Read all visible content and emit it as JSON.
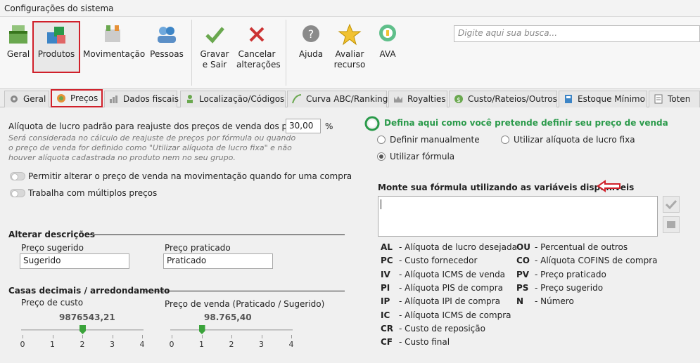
{
  "window": {
    "title": "Configurações do sistema"
  },
  "toolbar": {
    "geral": "Geral",
    "produtos": "Produtos",
    "movimentacao": "Movimentação",
    "pessoas": "Pessoas",
    "gravar_line1": "Gravar",
    "gravar_line2": "e Sair",
    "cancelar_line1": "Cancelar",
    "cancelar_line2": "alterações",
    "ajuda": "Ajuda",
    "avaliar_line1": "Avaliar",
    "avaliar_line2": "recurso",
    "ava": "AVA"
  },
  "search": {
    "placeholder": "Digite aqui sua busca..."
  },
  "tabs": [
    "Geral",
    "Preços",
    "Dados fiscais",
    "Localização/Códigos",
    "Curva ABC/Ranking",
    "Royalties",
    "Custo/Rateios/Outros",
    "Estoque Mínimo",
    "Toten"
  ],
  "left": {
    "profit_label": "Alíquota de lucro padrão para reajuste dos preços de venda dos produtos",
    "profit_value": "30,00",
    "profit_unit": "%",
    "note1": "Será considerada no cálculo de reajuste de preços por fórmula ou quando",
    "note2": "o preço de venda for definido como \"Utilizar alíquota de lucro fixa\" e não",
    "note3": "houver alíquota cadastrada no produto nem no seu grupo.",
    "toggle1": "Permitir alterar o preço de venda na movimentação quando for uma compra",
    "toggle2": "Trabalha com múltiplos preços",
    "alter_title": "Alterar descrições",
    "sugerido_label": "Preço sugerido",
    "sugerido_value": "Sugerido",
    "praticado_label": "Preço praticado",
    "praticado_value": "Praticado",
    "casas_title": "Casas decimais / arredondamento",
    "custo_label": "Preço de custo",
    "custo_value": "9876543,21",
    "custo_level": 2,
    "venda_label": "Preço de venda (Praticado / Sugerido)",
    "venda_value": "98.765,40",
    "venda_level": 1,
    "ticks": [
      "0",
      "1",
      "2",
      "3",
      "4"
    ]
  },
  "right": {
    "define_title": "Defina aqui como você pretende definir seu preço de venda",
    "opt_manual": "Definir manualmente",
    "opt_fixa": "Utilizar alíquota de lucro fixa",
    "opt_formula": "Utilizar fórmula",
    "formula_title": "Monte sua fórmula utilizando as variáveis disponíveis",
    "vars_left": [
      {
        "code": "AL",
        "desc": "- Alíquota de lucro desejada"
      },
      {
        "code": "PC",
        "desc": "- Custo fornecedor"
      },
      {
        "code": "IV",
        "desc": "- Alíquota ICMS de venda"
      },
      {
        "code": "PI",
        "desc": "- Alíquota PIS de compra"
      },
      {
        "code": "IP",
        "desc": "- Alíquota IPI de compra"
      },
      {
        "code": "IC",
        "desc": "- Alíquota ICMS de compra"
      },
      {
        "code": "CR",
        "desc": "- Custo de reposição"
      },
      {
        "code": "CF",
        "desc": "- Custo final"
      }
    ],
    "vars_right": [
      {
        "code": "OU",
        "desc": "- Percentual de outros"
      },
      {
        "code": "CO",
        "desc": "- Alíquota COFINS de compra"
      },
      {
        "code": "PV",
        "desc": "- Preço praticado"
      },
      {
        "code": "PS",
        "desc": "- Preço sugerido"
      },
      {
        "code": "N",
        "desc": "- Número"
      }
    ]
  },
  "colors": {
    "accent_red": "#d0202a",
    "green_title": "#2a9a4a",
    "slider_green": "#3aa33a"
  }
}
